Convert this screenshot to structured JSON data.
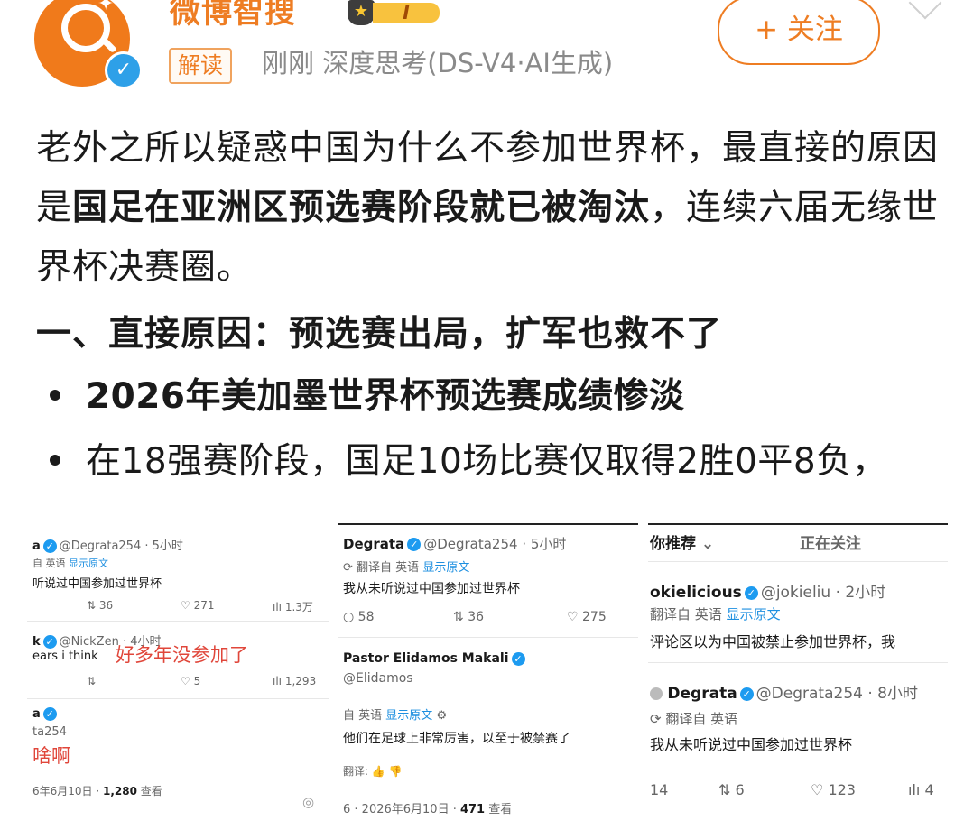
{
  "header": {
    "username": "微博智搜",
    "level": "I",
    "tag": "解读",
    "meta": "刚刚 深度思考(DS-V4·AI生成)",
    "follow_label": "+ 关注"
  },
  "content": {
    "para1_a": "老外之所以疑惑中国为什么不参加世界杯，最直接的原因是",
    "para1_bold": "国足在亚洲区预选赛阶段就已被淘汰",
    "para1_b": "，连续六届无缘世界杯决赛圈。",
    "heading1": "一、直接原因：预选赛出局，扩军也救不了",
    "bullet1": "2026年美加墨世界杯预选赛成绩惨淡",
    "bullet2": "在18强赛阶段，国足10场比赛仅取得2胜0平8负，"
  },
  "shot1": {
    "r1_name": "a",
    "r1_handle": "@Degrata254 · 5小时",
    "r1_translate": "自 英语",
    "r1_show_original": "显示原文",
    "r1_text": "听说过中国参加过世界杯",
    "r1_retweets": "36",
    "r1_likes": "271",
    "r1_views": "1.3万",
    "r2_name": "k",
    "r2_handle": "@NickZen · 4小时",
    "r2_text": "ears i think",
    "r2_annotation": "好多年没参加了",
    "r2_likes": "5",
    "r2_views": "1,293",
    "r3_name": "a",
    "r3_handle": "ta254",
    "r3_annotation": "啥啊",
    "r3_date": "6年6月10日 · ",
    "r3_views": "1,280",
    "r3_views_label": " 查看"
  },
  "shot2": {
    "name": "Degrata",
    "handle": "@Degrata254 · 5小时",
    "translate": "翻译自 英语",
    "show_original": "显示原文",
    "text": "我从未听说过中国参加过世界杯",
    "replies": "58",
    "retweets": "36",
    "likes": "275",
    "reply_name": "Pastor Elidamos Makali",
    "reply_handle": "@Elidamos",
    "reply_translate": "自 英语",
    "reply_show_original": "显示原文",
    "reply_text": "他们在足球上非常厉害，以至于被禁赛了",
    "reply_translate_label": "翻译:",
    "footer_date": "6 · 2026年6月10日 · ",
    "footer_views": "471",
    "footer_views_label": " 查看"
  },
  "shot3": {
    "tab_recommend": "你推荐",
    "tab_following": "正在关注",
    "r1_name": "okielicious",
    "r1_handle": "@jokieliu · 2小时",
    "r1_translate": "翻译自 英语",
    "r1_show_original": "显示原文",
    "r1_text": "评论区以为中国被禁止参加世界杯，我",
    "r2_name": "Degrata",
    "r2_handle": "@Degrata254 · 8小时",
    "r2_translate": "翻译自 英语",
    "r2_text": "我从未听说过中国参加过世界杯",
    "r2_replies": "14",
    "r2_retweets": "6",
    "r2_likes": "123",
    "r2_views": "4"
  },
  "colors": {
    "brand_orange": "#ee7d23",
    "link_blue": "#1d8fe0",
    "annotation_red": "#e0463a"
  }
}
